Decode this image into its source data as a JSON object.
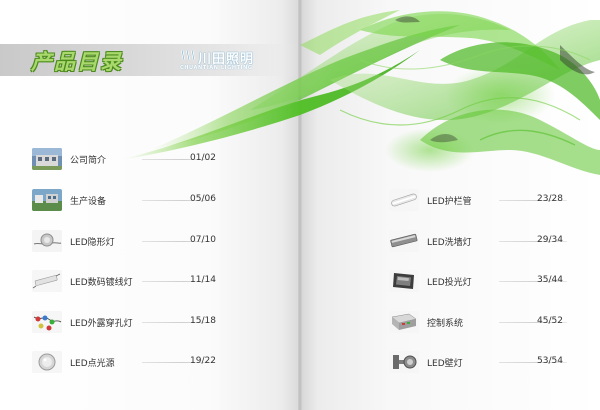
{
  "header": {
    "title": "产品目录",
    "logo_cn": "川田照明",
    "logo_en": "CHUANTIAN LIGHTING"
  },
  "toc_left": [
    {
      "label": "公司简介",
      "page": "01/02",
      "icon": "office-building-photo"
    },
    {
      "label": "生产设备",
      "page": "05/06",
      "icon": "factory-equipment-photo"
    },
    {
      "label": "LED隐形灯",
      "page": "07/10",
      "icon": "led-invisible-lamp"
    },
    {
      "label": "LED数码镀线灯",
      "page": "11/14",
      "icon": "led-digital-line-lamp"
    },
    {
      "label": "LED外露穿孔灯",
      "page": "15/18",
      "icon": "led-exposed-pixel-lamp"
    },
    {
      "label": "LED点光源",
      "page": "19/22",
      "icon": "led-point-light"
    }
  ],
  "toc_right": [
    {
      "label": "LED护栏管",
      "page": "23/28",
      "icon": "led-guardrail-tube"
    },
    {
      "label": "LED洗墙灯",
      "page": "29/34",
      "icon": "led-wall-washer"
    },
    {
      "label": "LED投光灯",
      "page": "35/44",
      "icon": "led-flood-light"
    },
    {
      "label": "控制系统",
      "page": "45/52",
      "icon": "control-box"
    },
    {
      "label": "LED壁灯",
      "page": "53/54",
      "icon": "led-wall-lamp"
    }
  ],
  "colors": {
    "accent_green": "#5cc02c",
    "title_green": "#a9d86d",
    "text": "#333333"
  }
}
